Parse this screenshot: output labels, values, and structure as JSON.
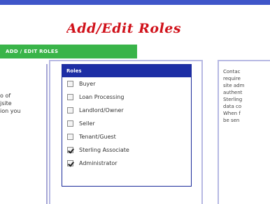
{
  "page": {
    "title": "Add/Edit Roles",
    "action_bar_label": "ADD / EDIT ROLES"
  },
  "left_panel": {
    "text": [
      "o of",
      "jsite",
      "ion you"
    ]
  },
  "roles": {
    "header": "Roles",
    "items": [
      {
        "label": "Buyer",
        "checked": false
      },
      {
        "label": "Loan Processing",
        "checked": false
      },
      {
        "label": "Landlord/Owner",
        "checked": false
      },
      {
        "label": "Seller",
        "checked": false
      },
      {
        "label": "Tenant/Guest",
        "checked": false
      },
      {
        "label": "Sterling Associate",
        "checked": true
      },
      {
        "label": "Administrator",
        "checked": true
      }
    ]
  },
  "right_panel": {
    "text": [
      "Contac",
      "require",
      "site adm",
      "authent",
      "Sterling",
      "data co",
      "When f",
      "be sen"
    ]
  },
  "colors": {
    "top_bar": "#3f56c9",
    "title": "#d0111a",
    "action_bar": "#39b449",
    "roles_header": "#1d2ea5"
  }
}
